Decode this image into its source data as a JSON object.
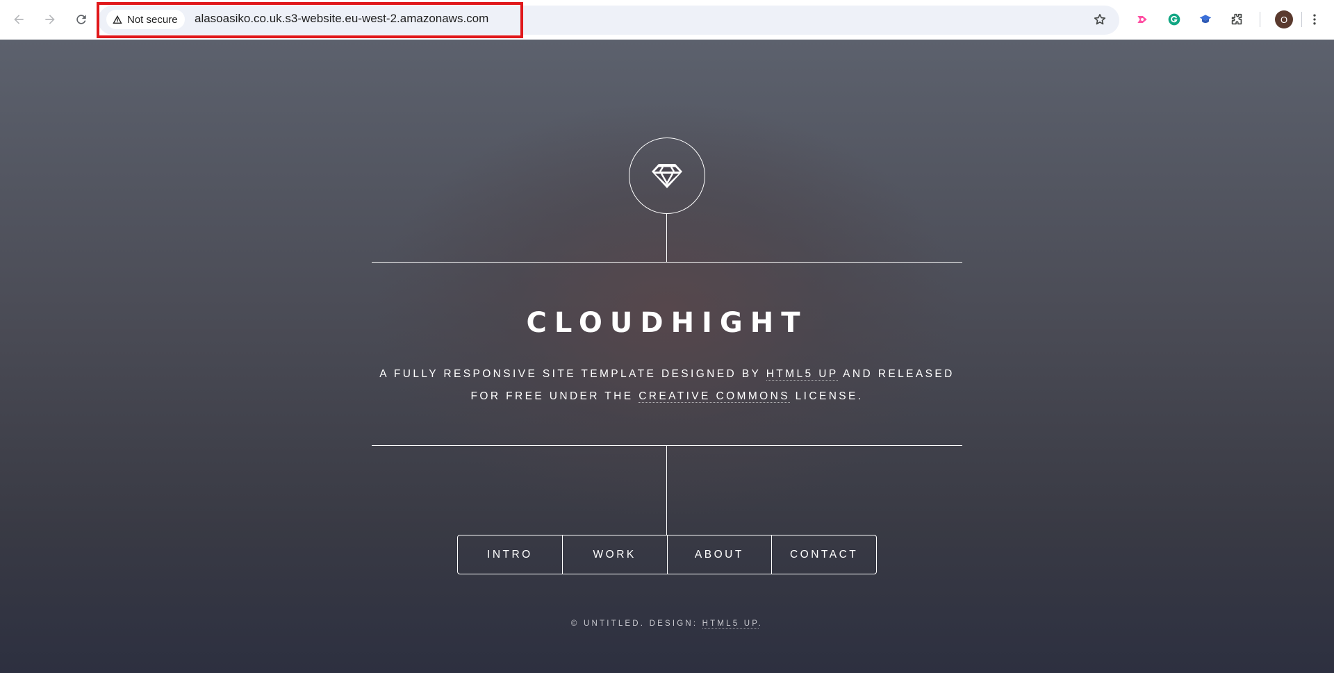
{
  "browser": {
    "back_icon": "arrow-left-icon",
    "forward_icon": "arrow-right-icon",
    "reload_icon": "reload-icon",
    "security_chip": "Not secure",
    "url": "alasoasiko.co.uk.s3-website.eu-west-2.amazonaws.com",
    "bookmark_icon": "star-icon",
    "extensions": [
      "screencast-extension-icon",
      "grammarly-extension-icon",
      "graduation-cap-extension-icon",
      "puzzle-extensions-icon"
    ],
    "profile_initial": "O",
    "menu_icon": "kebab-menu-icon",
    "highlight_color": "#e0181b"
  },
  "site": {
    "logo_icon": "diamond-icon",
    "title": "CLOUDHIGHT",
    "subtitle": {
      "part1": "A FULLY RESPONSIVE SITE TEMPLATE DESIGNED BY ",
      "link1": "HTML5 UP",
      "part2": " AND RELEASED",
      "part3": "FOR FREE UNDER THE ",
      "link2": "CREATIVE COMMONS",
      "part4": " LICENSE."
    },
    "nav": [
      "INTRO",
      "WORK",
      "ABOUT",
      "CONTACT"
    ],
    "footer": {
      "text": "© UNTITLED. DESIGN: ",
      "link": "HTML5 UP",
      "end": "."
    }
  }
}
